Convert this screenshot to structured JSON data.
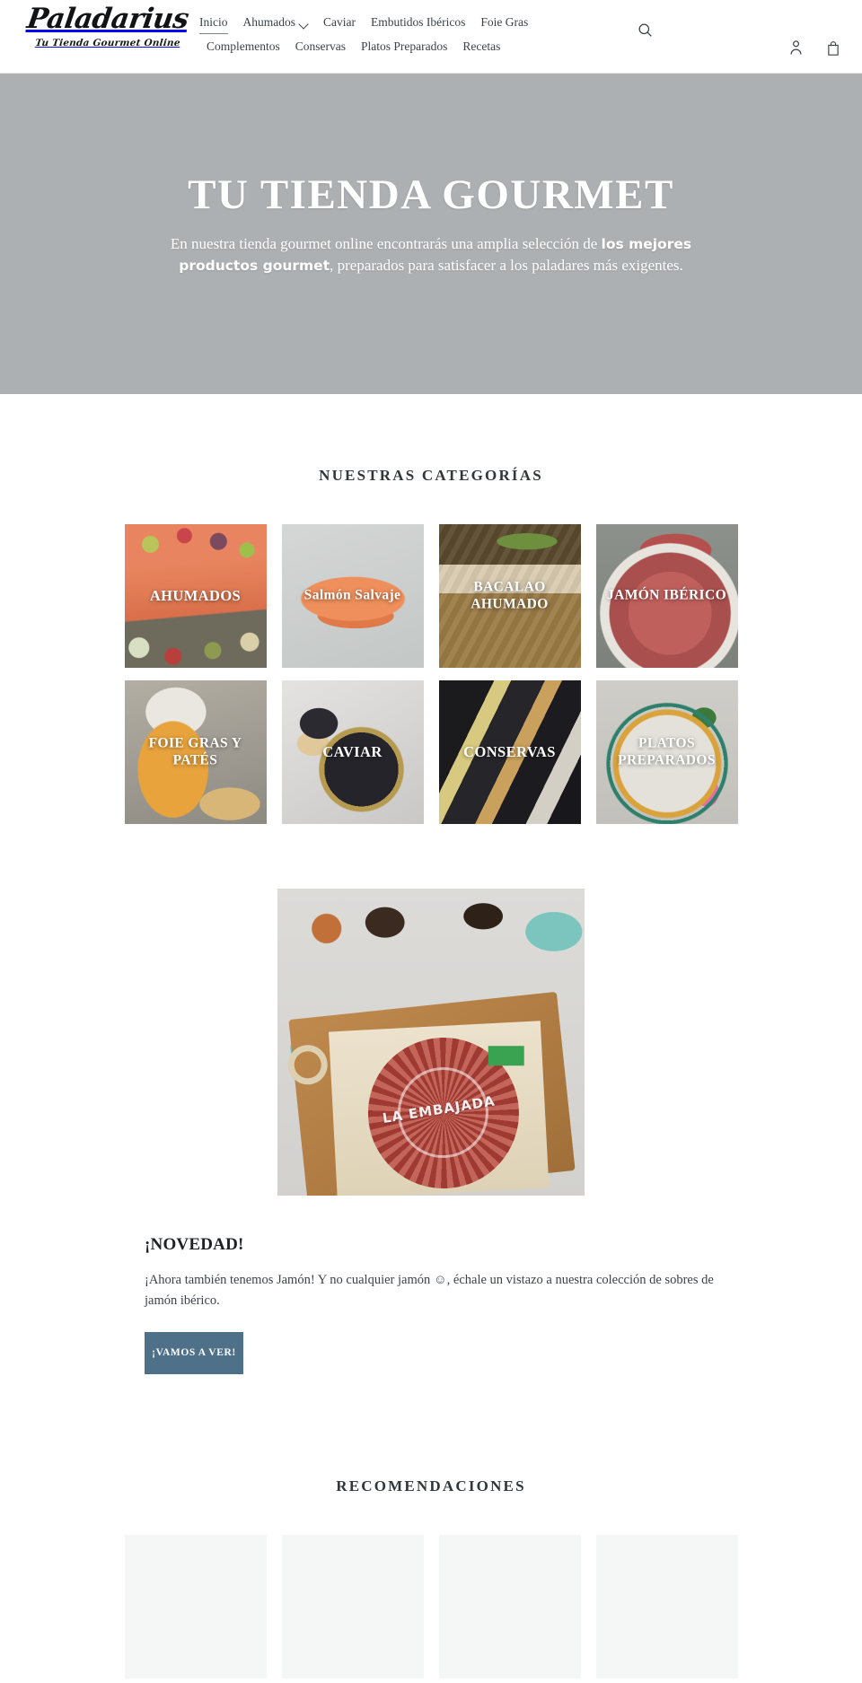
{
  "header": {
    "logo_word": "Paladarius",
    "logo_tagline": "Tu Tienda Gourmet Online",
    "nav_row1": [
      {
        "label": "Inicio",
        "active": true,
        "has_caret": false
      },
      {
        "label": "Ahumados",
        "active": false,
        "has_caret": true
      },
      {
        "label": "Caviar",
        "active": false,
        "has_caret": false
      },
      {
        "label": "Embutidos Ibéricos",
        "active": false,
        "has_caret": false
      },
      {
        "label": "Foie Gras",
        "active": false,
        "has_caret": false
      }
    ],
    "nav_row2": [
      {
        "label": "Complementos",
        "active": false,
        "has_caret": false
      },
      {
        "label": "Conservas",
        "active": false,
        "has_caret": false
      },
      {
        "label": "Platos Preparados",
        "active": false,
        "has_caret": false
      },
      {
        "label": "Recetas",
        "active": false,
        "has_caret": false
      }
    ],
    "search_icon": "search-icon",
    "account_icon": "account-person-icon",
    "cart_icon": "shopping-bag-icon"
  },
  "hero": {
    "title": "TU TIENDA GOURMET",
    "sub_part1": "En nuestra tienda gourmet online encontrarás una amplia selección de ",
    "sub_bold": "los mejores productos gourmet",
    "sub_part2": ", preparados para satisfacer a los paladares más exigentes.",
    "background_color": "#adb0b3"
  },
  "categories": {
    "heading": "NUESTRAS CATEGORÍAS",
    "items": [
      {
        "label": "AHUMADOS",
        "art": "ph-ahumados"
      },
      {
        "label": "Salmón Salvaje",
        "art": "ph-salmon"
      },
      {
        "label": "BACALAO AHUMADO",
        "art": "ph-bacalao"
      },
      {
        "label": "JAMÓN IBÉRICO",
        "art": "ph-jamon"
      },
      {
        "label": "FOIE GRAS Y PATÉS",
        "art": "ph-foie"
      },
      {
        "label": "CAVIAR",
        "art": "ph-caviar"
      },
      {
        "label": "CONSERVAS",
        "art": "ph-conservas"
      },
      {
        "label": "PLATOS PREPARADOS",
        "art": "ph-platos"
      }
    ]
  },
  "feature": {
    "image_label": "LA EMBAJADA",
    "title": "¡NOVEDAD!",
    "text": "¡Ahora también tenemos Jamón! Y no cualquier jamón ☺, échale un vistazo a nuestra colección de sobres de jamón ibérico.",
    "cta_label": "¡VAMOS A VER!",
    "cta_color": "#4f7089"
  },
  "recommendations": {
    "heading": "RECOMENDACIONES",
    "placeholder_count": 4
  }
}
